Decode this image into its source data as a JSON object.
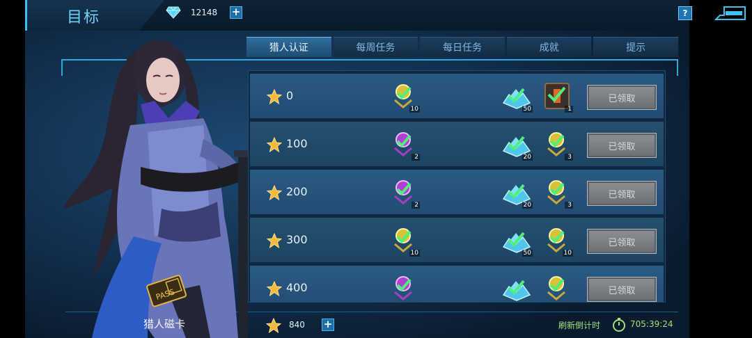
{
  "header": {
    "title": "目标",
    "currency": {
      "icon": "diamond-icon",
      "value": "12148",
      "add_label": "+"
    },
    "help_label": "?",
    "back_icon": "back-arrow-icon"
  },
  "tabs": [
    {
      "label": "猎人认证",
      "active": true
    },
    {
      "label": "每周任务",
      "active": false
    },
    {
      "label": "每日任务",
      "active": false
    },
    {
      "label": "成就",
      "active": false
    },
    {
      "label": "提示",
      "active": false
    }
  ],
  "rewards": [
    {
      "stars": "0",
      "items": [
        {
          "icon": "gold-skill-orb-icon",
          "count": "10"
        },
        {
          "icon": "diamond-pile-icon",
          "count": "50"
        },
        {
          "icon": "treasure-chest-icon",
          "count": "1"
        }
      ],
      "button": "已领取"
    },
    {
      "stars": "100",
      "items": [
        {
          "icon": "purple-skill-orb-icon",
          "count": "2"
        },
        {
          "icon": "diamond-pile-icon",
          "count": "20"
        },
        {
          "icon": "gold-skill-orb-icon",
          "count": "3"
        }
      ],
      "button": "已领取"
    },
    {
      "stars": "200",
      "items": [
        {
          "icon": "purple-skill-orb-icon",
          "count": "2"
        },
        {
          "icon": "diamond-pile-icon",
          "count": "20"
        },
        {
          "icon": "gold-skill-orb-icon",
          "count": "3"
        }
      ],
      "button": "已领取"
    },
    {
      "stars": "300",
      "items": [
        {
          "icon": "gold-skill-orb-icon",
          "count": "10"
        },
        {
          "icon": "diamond-pile-icon",
          "count": "50"
        },
        {
          "icon": "gold-skill-orb-icon",
          "count": "10"
        }
      ],
      "button": "已领取"
    },
    {
      "stars": "400",
      "items": [
        {
          "icon": "purple-skill-orb-icon",
          "count": ""
        },
        {
          "icon": "diamond-pile-icon",
          "count": ""
        },
        {
          "icon": "gold-skill-orb-icon",
          "count": ""
        }
      ],
      "button": "已领取"
    }
  ],
  "card": {
    "label": "猎人磁卡",
    "pass_text": "PASS"
  },
  "footer": {
    "stars": "840",
    "add_label": "+",
    "refresh_label": "刷新倒计时",
    "refresh_time": "705:39:24"
  },
  "colors": {
    "accent": "#3fc3ee",
    "timer": "#9fe07a",
    "claimed_button": "#7d8084"
  }
}
